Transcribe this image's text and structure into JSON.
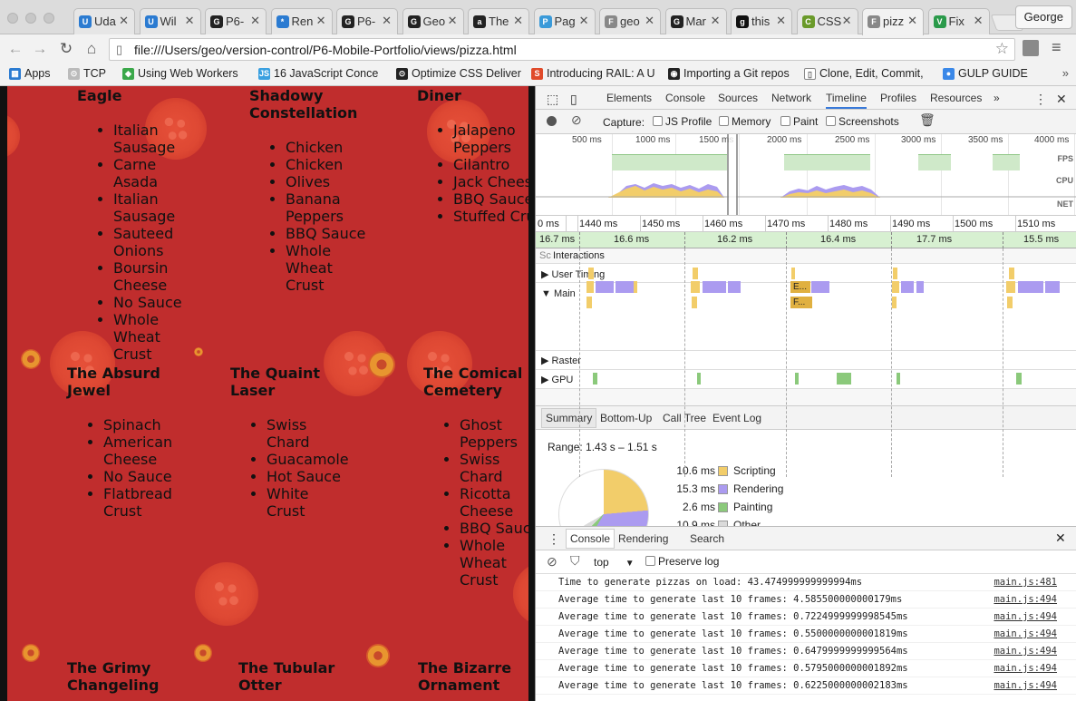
{
  "tabs": [
    {
      "label": "Uda",
      "icon": "U"
    },
    {
      "label": "Wil",
      "icon": "U"
    },
    {
      "label": "P6-",
      "icon": "G"
    },
    {
      "label": "Ren",
      "icon": "*"
    },
    {
      "label": "P6-",
      "icon": "G"
    },
    {
      "label": "Geo",
      "icon": "G"
    },
    {
      "label": "The",
      "icon": "a"
    },
    {
      "label": "Pag",
      "icon": "P"
    },
    {
      "label": "geo",
      "icon": "F"
    },
    {
      "label": "Mar",
      "icon": "G"
    },
    {
      "label": "this",
      "icon": "g"
    },
    {
      "label": "CSS",
      "icon": "C"
    },
    {
      "label": "pizz",
      "icon": "F"
    },
    {
      "label": "Fix",
      "icon": "V"
    }
  ],
  "profile": "George",
  "address": "file:///Users/geo/version-control/P6-Mobile-Portfolio/views/pizza.html",
  "bookmarks": [
    {
      "label": "Apps"
    },
    {
      "label": "TCP"
    },
    {
      "label": "Using Web Workers"
    },
    {
      "label": "16 JavaScript Conce"
    },
    {
      "label": "Optimize CSS Deliver"
    },
    {
      "label": "Introducing RAIL: A U"
    },
    {
      "label": "Importing a Git repos"
    },
    {
      "label": "Clone, Edit, Commit,"
    },
    {
      "label": "GULP GUIDE"
    }
  ],
  "pizzas": [
    {
      "name": "Eagle",
      "ingredients": [
        "Italian Sausage",
        "Carne Asada",
        "Italian Sausage",
        "Sauteed Onions",
        "Boursin Cheese",
        "No Sauce",
        "Whole Wheat Crust"
      ]
    },
    {
      "name": "Shadowy Constellation",
      "ingredients": [
        "Chicken",
        "Chicken",
        "Olives",
        "Banana Peppers",
        "BBQ Sauce",
        "Whole Wheat Crust"
      ]
    },
    {
      "name": "Diner",
      "ingredients": [
        "Jalapeno Peppers",
        "Cilantro",
        "Jack Cheese",
        "BBQ Sauce",
        "Stuffed Crust"
      ]
    },
    {
      "name": "The Absurd Jewel",
      "ingredients": [
        "Spinach",
        "American Cheese",
        "No Sauce",
        "Flatbread Crust"
      ]
    },
    {
      "name": "The Quaint Laser",
      "ingredients": [
        "Swiss Chard",
        "Guacamole",
        "Hot Sauce",
        "White Crust"
      ]
    },
    {
      "name": "The Comical Cemetery",
      "ingredients": [
        "Ghost Peppers",
        "Swiss Chard",
        "Ricotta Cheese",
        "BBQ Sauce",
        "Whole Wheat Crust"
      ]
    },
    {
      "name": "The Grimy Changeling",
      "ingredients": []
    },
    {
      "name": "The Tubular Otter",
      "ingredients": []
    },
    {
      "name": "The Bizarre Ornament",
      "ingredients": []
    }
  ],
  "devtools": {
    "tabs": [
      "Elements",
      "Console",
      "Sources",
      "Network",
      "Timeline",
      "Profiles",
      "Resources"
    ],
    "more": "»",
    "capture_label": "Capture:",
    "capture_options": [
      "JS Profile",
      "Memory",
      "Paint",
      "Screenshots"
    ],
    "overview_ticks": [
      "500 ms",
      "1000 ms",
      "1500 ms",
      "2000 ms",
      "2500 ms",
      "3000 ms",
      "3500 ms",
      "4000 ms"
    ],
    "overview_labels": [
      "FPS",
      "CPU",
      "NET"
    ],
    "ruler_ticks": [
      "0 ms",
      "1440 ms",
      "1450 ms",
      "1460 ms",
      "1470 ms",
      "1480 ms",
      "1490 ms",
      "1500 ms",
      "1510 ms"
    ],
    "frames": [
      "16.7 ms",
      "16.6 ms",
      "16.2 ms",
      "16.4 ms",
      "17.7 ms",
      "15.5 ms"
    ],
    "tracks": {
      "interactions": "Interactions",
      "interactions_prefix": "Sc",
      "user_timing": "User Timing",
      "main": "Main",
      "raster": "Raster",
      "gpu": "GPU"
    },
    "main_event_labels": [
      "E...",
      "F..."
    ],
    "summary_tabs": [
      "Summary",
      "Bottom-Up",
      "Call Tree",
      "Event Log"
    ],
    "range": "Range: 1.43 s – 1.51 s",
    "legend": [
      {
        "value": "10.6 ms",
        "label": "Scripting",
        "color": "#f2cd6a"
      },
      {
        "value": "15.3 ms",
        "label": "Rendering",
        "color": "#ab9bf0"
      },
      {
        "value": "2.6 ms",
        "label": "Painting",
        "color": "#8bc97b"
      },
      {
        "value": "10.9 ms",
        "label": "Other",
        "color": "#dadada"
      }
    ],
    "drawer_tabs": [
      "Console",
      "Rendering",
      "Search"
    ],
    "context": "top",
    "preserve_log": "Preserve log",
    "logs": [
      {
        "msg": "Time to generate pizzas on load: 43.474999999999994ms",
        "src": "main.js:481"
      },
      {
        "msg": "Average time to generate last 10 frames: 4.585500000000179ms",
        "src": "main.js:494"
      },
      {
        "msg": "Average time to generate last 10 frames: 0.7224999999998545ms",
        "src": "main.js:494"
      },
      {
        "msg": "Average time to generate last 10 frames: 0.5500000000001819ms",
        "src": "main.js:494"
      },
      {
        "msg": "Average time to generate last 10 frames: 0.6479999999999564ms",
        "src": "main.js:494"
      },
      {
        "msg": "Average time to generate last 10 frames: 0.5795000000001892ms",
        "src": "main.js:494"
      },
      {
        "msg": "Average time to generate last 10 frames: 0.6225000000002183ms",
        "src": "main.js:494"
      }
    ]
  }
}
